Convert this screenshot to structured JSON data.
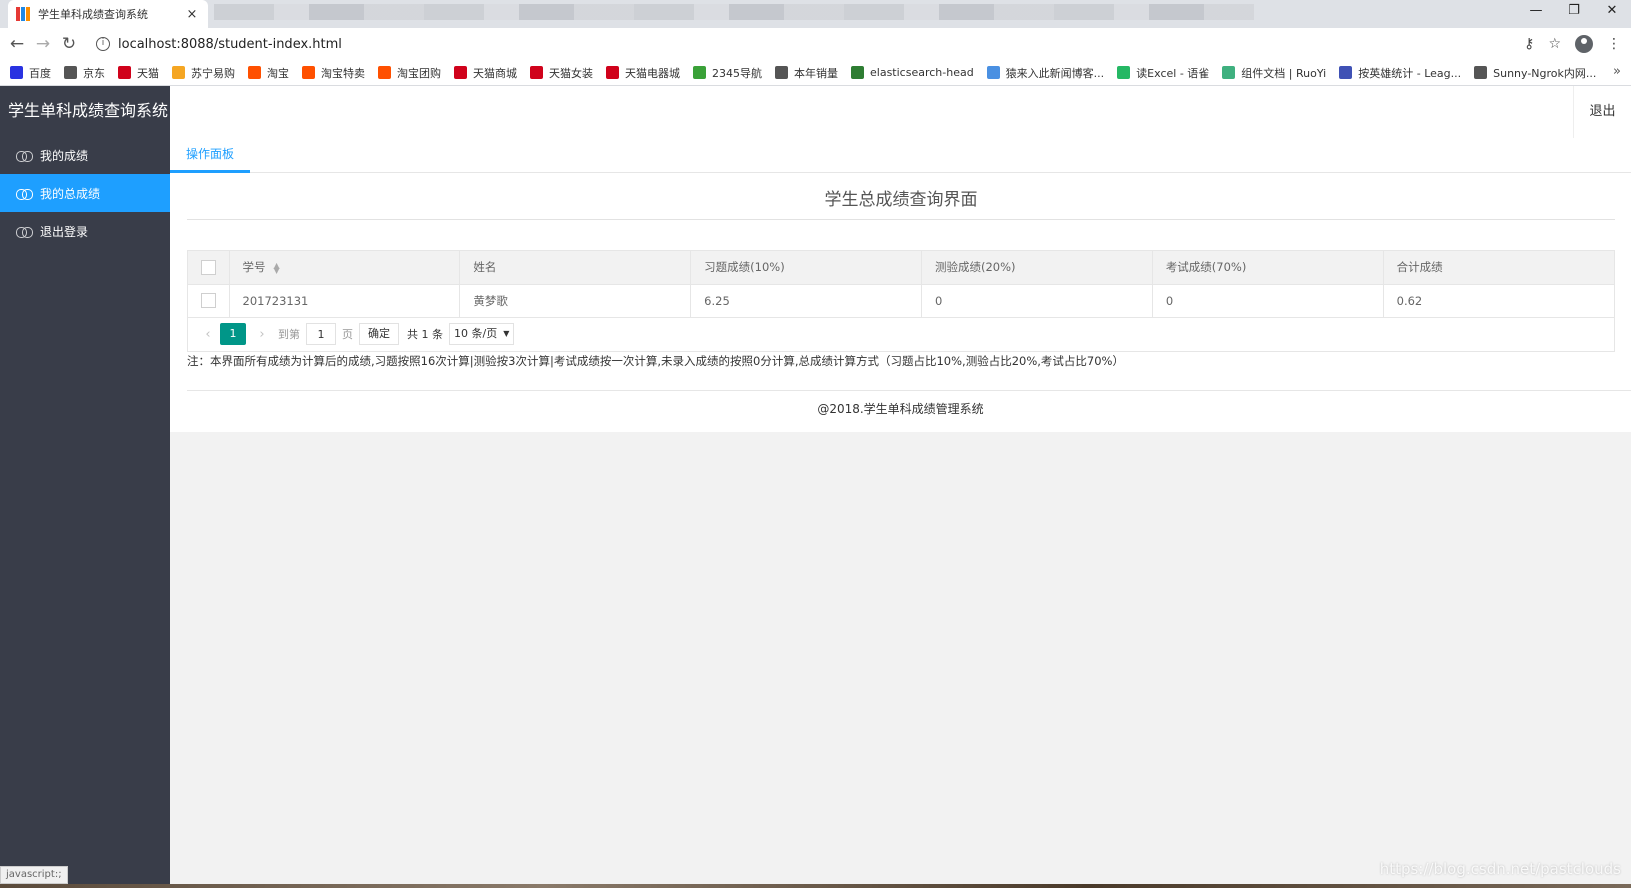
{
  "browser": {
    "tab_title": "学生单科成绩查询系统",
    "tab_close": "×",
    "url": "localhost:8088/student-index.html",
    "window_controls": {
      "minimize": "—",
      "restore": "❐",
      "close": "✕"
    },
    "bookmarks": [
      {
        "label": "百度",
        "icon": "baidu-icon",
        "color": "#2932e1"
      },
      {
        "label": "京东",
        "icon": "globe-icon",
        "color": "#555555"
      },
      {
        "label": "天猫",
        "icon": "tmall-icon",
        "color": "#d0021b"
      },
      {
        "label": "苏宁易购",
        "icon": "suning-icon",
        "color": "#f5a623"
      },
      {
        "label": "淘宝",
        "icon": "taobao-icon",
        "color": "#ff5000"
      },
      {
        "label": "淘宝特卖",
        "icon": "taobao-icon",
        "color": "#ff5000"
      },
      {
        "label": "淘宝团购",
        "icon": "taobao-icon",
        "color": "#ff5000"
      },
      {
        "label": "天猫商城",
        "icon": "tmall-icon",
        "color": "#d0021b"
      },
      {
        "label": "天猫女装",
        "icon": "tmall-icon",
        "color": "#d0021b"
      },
      {
        "label": "天猫电器城",
        "icon": "tmall-icon",
        "color": "#d0021b"
      },
      {
        "label": "2345导航",
        "icon": "nav2345-icon",
        "color": "#3aa138"
      },
      {
        "label": "本年销量",
        "icon": "globe-icon",
        "color": "#555555"
      },
      {
        "label": "elasticsearch-head",
        "icon": "elastic-icon",
        "color": "#2e7d32"
      },
      {
        "label": "猿来入此新闻博客...",
        "icon": "blog-icon",
        "color": "#4a90e2"
      },
      {
        "label": "读Excel - 语雀",
        "icon": "yuque-icon",
        "color": "#25b864"
      },
      {
        "label": "组件文档 | RuoYi",
        "icon": "ruoyi-icon",
        "color": "#3fb07f"
      },
      {
        "label": "按英雄统计 - Leag...",
        "icon": "league-icon",
        "color": "#3f51b5"
      },
      {
        "label": "Sunny-Ngrok内网...",
        "icon": "globe-icon",
        "color": "#555555"
      }
    ],
    "bookmarks_more": "»",
    "status_text": "javascript:;"
  },
  "app": {
    "logo": "学生单科成绩查询系统",
    "logout_top": "退出",
    "sidebar": [
      {
        "label": "我的成绩",
        "active": false
      },
      {
        "label": "我的总成绩",
        "active": true
      },
      {
        "label": "退出登录",
        "active": false
      }
    ],
    "tab": "操作面板",
    "page_title": "学生总成绩查询界面",
    "table": {
      "columns": [
        "学号",
        "姓名",
        "习题成绩(10%)",
        "测验成绩(20%)",
        "考试成绩(70%)",
        "合计成绩"
      ],
      "rows": [
        [
          "201723131",
          "黄梦歌",
          "6.25",
          "0",
          "0",
          "0.62"
        ]
      ]
    },
    "pagination": {
      "prev": "‹",
      "current": "1",
      "next": "›",
      "goto_label": "到第",
      "goto_value": "1",
      "page_unit": "页",
      "confirm": "确定",
      "total": "共 1 条",
      "page_size": "10 条/页"
    },
    "note": "注：本界面所有成绩为计算后的成绩,习题按照16次计算|测验按3次计算|考试成绩按一次计算,未录入成绩的按照0分计算,总成绩计算方式（习题占比10%,测验占比20%,考试占比70%）",
    "footer": "@2018.学生单科成绩管理系统"
  },
  "watermark": "https://blog.csdn.net/pastclouds",
  "colors": {
    "sidebar_bg": "#393d49",
    "active_blue": "#1e9fff",
    "pager_teal": "#009688"
  }
}
